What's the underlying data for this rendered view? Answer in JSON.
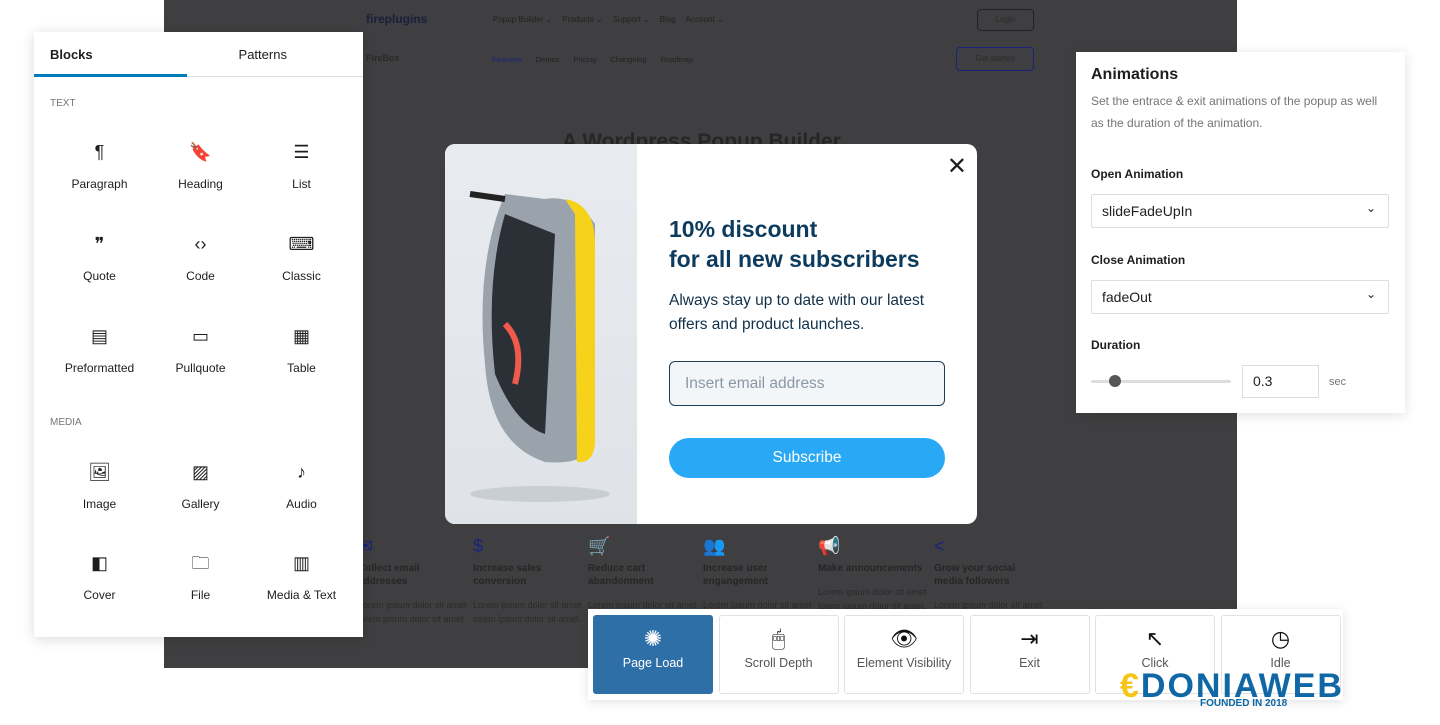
{
  "site": {
    "logo": "fireplugins",
    "nav": [
      "Popup Builder ⌄",
      "Products ⌄",
      "Support ⌄",
      "Blog",
      "Account ⌄"
    ],
    "login": "Login",
    "product": "FireBox",
    "subnav": [
      "Features",
      "Demos",
      "Pricing",
      "Changelog",
      "Roadmap"
    ],
    "cta": "Get started",
    "headline": "A Wordpress Popup Builder",
    "features": [
      {
        "icon": "✉",
        "title": "Collect email addresses",
        "desc": "Lorem ipsum dolor sit amet lorem ipsum dolor sit amet."
      },
      {
        "icon": "$",
        "title": "Increase sales conversion",
        "desc": "Lorem ipsum dolor sit amet lorem ipsum dolor sit amet."
      },
      {
        "icon": "🛒",
        "title": "Reduce cart abandonment",
        "desc": "Lorem ipsum dolor sit amet lorem ipsum dolor sit amet."
      },
      {
        "icon": "👥",
        "title": "Increase user engangement",
        "desc": "Lorem ipsum dolor sit amet lorem ipsum dolor sit amet."
      },
      {
        "icon": "📢",
        "title": "Make announcements",
        "desc": "Lorem ipsum dolor sit amet lorem ipsum dolor sit amet."
      },
      {
        "icon": "<",
        "title": "Grow your social media followers",
        "desc": "Lorem ipsum dolor sit amet lorem ipsum dolor sit amet."
      }
    ]
  },
  "inserter": {
    "tabs": [
      "Blocks",
      "Patterns"
    ],
    "sections": [
      {
        "title": "Text",
        "blocks": [
          {
            "icon": "¶",
            "label": "Paragraph"
          },
          {
            "icon": "🔖",
            "label": "Heading"
          },
          {
            "icon": "☰",
            "label": "List"
          },
          {
            "icon": "❞",
            "label": "Quote"
          },
          {
            "icon": "‹›",
            "label": "Code"
          },
          {
            "icon": "⌨",
            "label": "Classic"
          },
          {
            "icon": "▤",
            "label": "Preformatted"
          },
          {
            "icon": "▭",
            "label": "Pullquote"
          },
          {
            "icon": "▦",
            "label": "Table"
          }
        ]
      },
      {
        "title": "Media",
        "blocks": [
          {
            "icon": "🖼",
            "label": "Image"
          },
          {
            "icon": "▨",
            "label": "Gallery"
          },
          {
            "icon": "♪",
            "label": "Audio"
          },
          {
            "icon": "◧",
            "label": "Cover"
          },
          {
            "icon": "🗀",
            "label": "File"
          },
          {
            "icon": "▥",
            "label": "Media & Text"
          }
        ]
      }
    ]
  },
  "popup": {
    "heading1": "10% discount",
    "heading2": "for all new subscribers",
    "text": "Always stay up to date with our latest offers and product launches.",
    "email_placeholder": "Insert email address",
    "button": "Subscribe"
  },
  "animations": {
    "title": "Animations",
    "description": "Set the entrace & exit animations of the popup as well as the duration of the animation.",
    "open_label": "Open Animation",
    "open_value": "slideFadeUpIn",
    "close_label": "Close Animation",
    "close_value": "fadeOut",
    "duration_label": "Duration",
    "duration_value": "0.3",
    "duration_unit": "sec",
    "duration_slider_fraction": 0.17
  },
  "triggers": [
    {
      "icon": "✺",
      "label": "Page Load",
      "active": true
    },
    {
      "icon": "🖱",
      "label": "Scroll Depth"
    },
    {
      "icon": "👁",
      "label": "Element Visibility"
    },
    {
      "icon": "⇥",
      "label": "Exit"
    },
    {
      "icon": "↖",
      "label": "Click"
    },
    {
      "icon": "◷",
      "label": "Idle"
    }
  ],
  "watermark": {
    "logo": "DONIAWEB",
    "tagline": "FOUNDED IN 2018"
  },
  "colors": {
    "accent": "#007cba",
    "active_trigger": "#2f6fa7",
    "subscribe": "#29a8f5",
    "heading": "#0d3b5e"
  }
}
